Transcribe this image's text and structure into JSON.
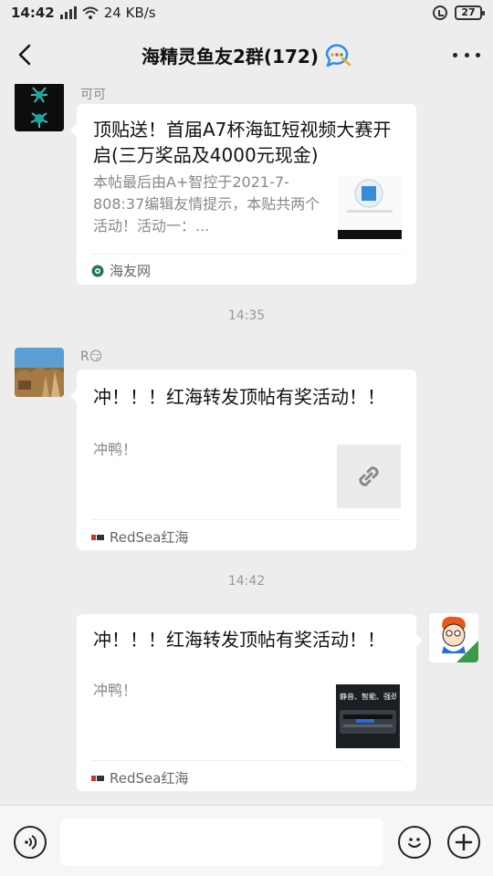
{
  "status_bar": {
    "time": "14:42",
    "net_speed": "24 KB/s",
    "battery": "27"
  },
  "header": {
    "title": "海精灵鱼友2群(172)"
  },
  "messages": [
    {
      "sender": "可可",
      "title": "顶贴送！首届A7杯海缸短视频大赛开启(三万奖品及4000元现金)",
      "desc": "本帖最后由A+智控于2021-7-808:37编辑友情提示，本贴共两个活动！活动一：...",
      "source": "海友网"
    },
    {
      "timestamp": "14:35",
      "sender": "R😏",
      "title": "冲！！！红海转发顶帖有奖活动！！",
      "desc": "冲鸭！",
      "source": "RedSea红海"
    },
    {
      "timestamp": "14:42",
      "title": "冲！！！红海转发顶帖有奖活动！！",
      "desc": "冲鸭！",
      "source": "RedSea红海",
      "thumb_text": "静音、智能、强劲"
    }
  ],
  "input": {
    "value": ""
  }
}
